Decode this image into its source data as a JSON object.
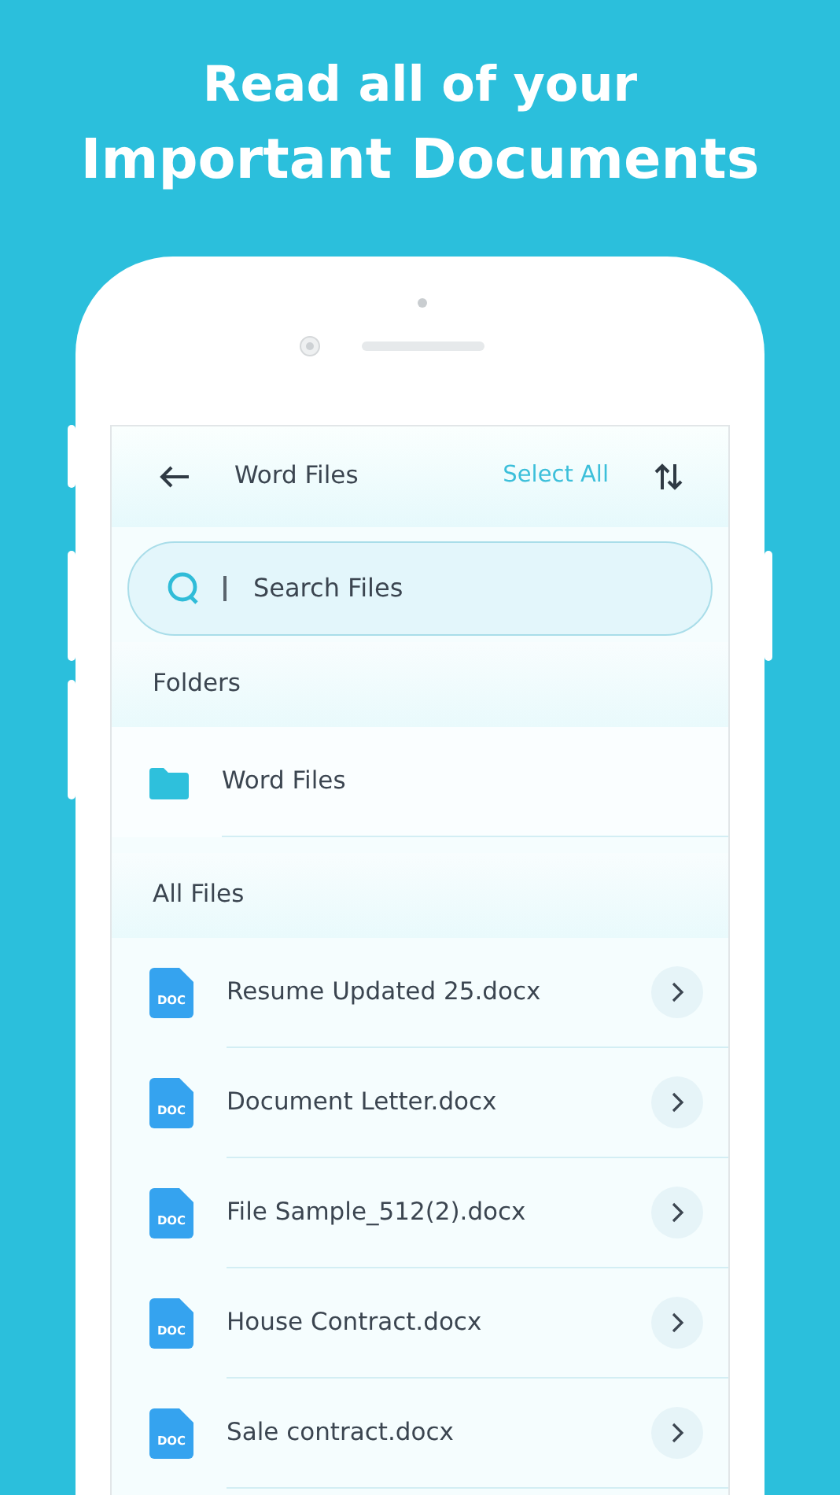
{
  "headline": [
    "Read all of your",
    "Important Documents"
  ],
  "header": {
    "title": "Word Files",
    "action": "Select All"
  },
  "search": {
    "placeholder": "Search Files"
  },
  "folders": {
    "label": "Folders",
    "items": [
      {
        "name": "Word Files"
      }
    ]
  },
  "files": {
    "label": "All Files",
    "items": [
      {
        "name": "Resume Updated 25.docx",
        "badge": "DOC"
      },
      {
        "name": "Document Letter.docx",
        "badge": "DOC"
      },
      {
        "name": "File Sample_512(2).docx",
        "badge": "DOC"
      },
      {
        "name": "House Contract.docx",
        "badge": "DOC"
      },
      {
        "name": "Sale contract.docx",
        "badge": "DOC"
      }
    ]
  }
}
